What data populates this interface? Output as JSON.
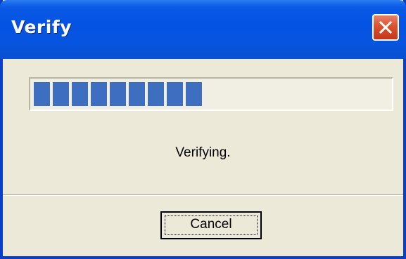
{
  "window": {
    "title": "Verify",
    "close_icon": "close-x-icon"
  },
  "progress": {
    "segments_filled": 9,
    "status_text": "Verifying."
  },
  "buttons": {
    "cancel_label": "Cancel"
  },
  "colors": {
    "titlebar": "#0553e3",
    "progress_fill": "#3d6ebf",
    "dialog_bg": "#ece9d8",
    "close_button": "#d9532f"
  }
}
